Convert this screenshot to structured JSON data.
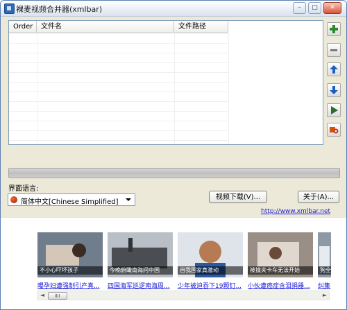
{
  "window": {
    "title": "裸麦视频合并器(xmlbar)",
    "controls": {
      "minimize": "–",
      "maximize": "□",
      "close": "✕"
    }
  },
  "list": {
    "columns": [
      "Order",
      "文件名",
      "文件路径"
    ],
    "rows": []
  },
  "toolbar": {
    "buttons": [
      {
        "name": "add-file-button",
        "icon": "plus-icon",
        "color": "#2c8a2c"
      },
      {
        "name": "remove-file-button",
        "icon": "minus-icon",
        "color": "#777777"
      },
      {
        "name": "move-up-button",
        "icon": "arrow-up-icon",
        "color": "#1f5fbf"
      },
      {
        "name": "move-down-button",
        "icon": "arrow-down-icon",
        "color": "#1f5fbf"
      },
      {
        "name": "start-merge-button",
        "icon": "play-icon",
        "color": "#2e6b2e"
      },
      {
        "name": "settings-button",
        "icon": "film-gear-icon",
        "color": "#c0392b"
      }
    ]
  },
  "progress": {
    "value": 0
  },
  "language": {
    "label": "界面语言:",
    "selected": "简体中文[Chinese Simplified]",
    "flag_color": "#c0391b"
  },
  "buttons": {
    "download": "视频下载(V)...",
    "about": "关于(A)..."
  },
  "link": {
    "text": "http://www.xmlbar.net"
  },
  "gallery": {
    "items": [
      {
        "caption": "不小心吓坏孩子",
        "title": "曝孕妇遭强制引产真...",
        "bg": "#6f7d8c"
      },
      {
        "caption": "今晚俯瞰南海问中国",
        "title": "四国海军巡逻南海周...",
        "bg": "#4a4d52"
      },
      {
        "caption": "自我国家真激动",
        "title": "少年被迫吞下19颗钉...",
        "bg": "#b77b54"
      },
      {
        "caption": "被撞夹卡车无法开始",
        "title": "小伙遭癌症含泪捐器...",
        "bg": "#9a8f86"
      },
      {
        "caption": "狗全",
        "title": "纠集",
        "bg": "#8d9aa6"
      }
    ],
    "scroll": {
      "left": "◄",
      "right": "►"
    }
  }
}
